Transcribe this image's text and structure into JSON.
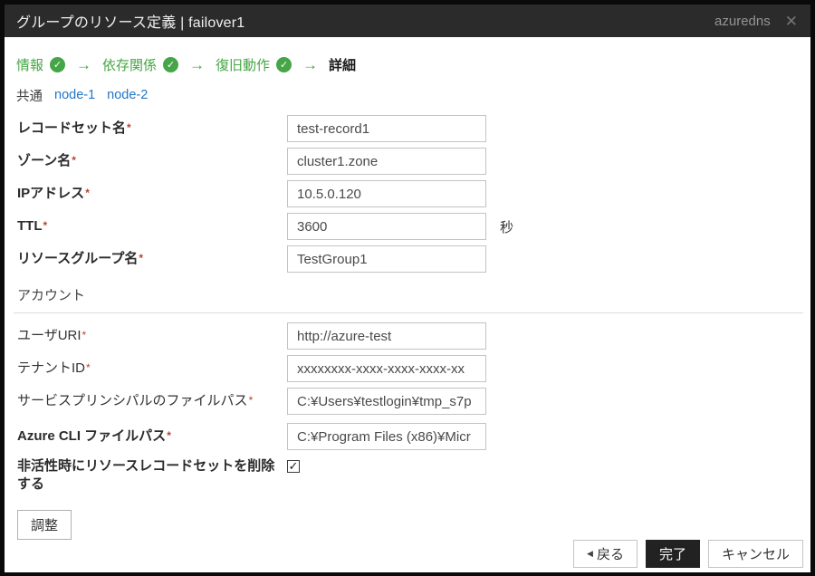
{
  "titlebar": {
    "title": "グループのリソース定義 | failover1",
    "right_text": "azuredns"
  },
  "icons": {
    "close": "✕",
    "check": "✓",
    "arrow": "→",
    "back_triangle": "◀"
  },
  "steps": [
    {
      "label": "情報",
      "done": true
    },
    {
      "label": "依存関係",
      "done": true
    },
    {
      "label": "復旧動作",
      "done": true
    },
    {
      "label": "詳細",
      "done": false,
      "current": true
    }
  ],
  "tabs": [
    {
      "label": "共通",
      "active": true
    },
    {
      "label": "node-1",
      "active": false
    },
    {
      "label": "node-2",
      "active": false
    }
  ],
  "form": {
    "common_fields": [
      {
        "label": "レコードセット名",
        "required": "*",
        "value": "test-record1"
      },
      {
        "label": "ゾーン名",
        "required": "*",
        "value": "cluster1.zone"
      },
      {
        "label": "IPアドレス",
        "required": "*",
        "value": "10.5.0.120"
      },
      {
        "label": "TTL",
        "required": "*",
        "value": "3600",
        "unit": "秒"
      },
      {
        "label": "リソースグループ名",
        "required": "*",
        "value": "TestGroup1"
      }
    ],
    "account_section_title": "アカウント",
    "account_fields": [
      {
        "label": "ユーザURI",
        "required": "*",
        "value": "http://azure-test"
      },
      {
        "label": "テナントID",
        "required": "*",
        "value": "xxxxxxxx-xxxx-xxxx-xxxx-xx"
      },
      {
        "label": "サービスプリンシパルのファイルパス",
        "required": "*",
        "value": "C:¥Users¥testlogin¥tmp_s7p"
      }
    ],
    "cli_field": {
      "label": "Azure CLI ファイルパス",
      "required": "*",
      "value": "C:¥Program Files (x86)¥Micr"
    },
    "checkbox_field": {
      "label": "非活性時にリソースレコードセットを削除する",
      "checked": true
    }
  },
  "buttons": {
    "tune": "調整",
    "back": "戻る",
    "finish": "完了",
    "cancel": "キャンセル"
  },
  "colors": {
    "titlebar_bg": "#2b2b2b",
    "accent_green": "#46a546",
    "link_blue": "#2277c8",
    "required_red": "#b3442e",
    "finish_button_bg": "#222222"
  }
}
